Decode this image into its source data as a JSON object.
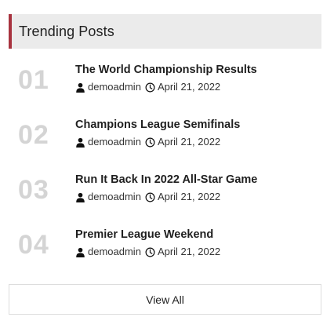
{
  "widget": {
    "title": "Trending Posts",
    "accent_color": "#a8333f",
    "view_all_label": "View All"
  },
  "posts": [
    {
      "number": "01",
      "title": "The World Championship Results",
      "author": "demoadmin",
      "date": "April 21, 2022"
    },
    {
      "number": "02",
      "title": "Champions League Semifinals",
      "author": "demoadmin",
      "date": "April 21, 2022"
    },
    {
      "number": "03",
      "title": "Run It Back In 2022 All-Star Game",
      "author": "demoadmin",
      "date": "April 21, 2022"
    },
    {
      "number": "04",
      "title": "Premier League Weekend",
      "author": "demoadmin",
      "date": "April 21, 2022"
    }
  ],
  "icons": {
    "author": "user-icon",
    "date": "clock-icon"
  }
}
